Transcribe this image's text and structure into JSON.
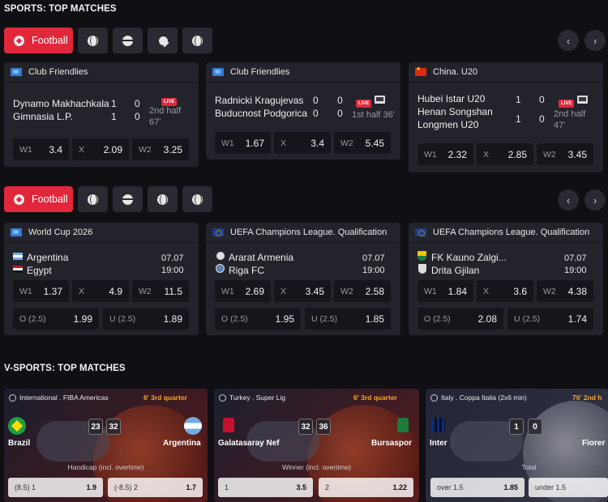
{
  "sports_title": "SPORTS: TOP MATCHES",
  "vsports_title": "V-SPORTS: TOP MATCHES",
  "tabs": {
    "active_label": "Football"
  },
  "nav": {
    "prev": "‹",
    "next": "›"
  },
  "live_label": "LIVE",
  "row1": [
    {
      "league": "Club Friendlies",
      "team1": "Dynamo Makhachkala",
      "team2": "Gimnasia L.P.",
      "s1a": "1",
      "s1b": "0",
      "s2a": "1",
      "s2b": "0",
      "period": "2nd half",
      "minute": "67'",
      "odds": [
        {
          "k": "W1",
          "v": "3.4"
        },
        {
          "k": "X",
          "v": "2.09"
        },
        {
          "k": "W2",
          "v": "3.25"
        }
      ]
    },
    {
      "league": "Club Friendlies",
      "team1": "Radnicki Kragujevas",
      "team2": "Buducnost Podgorica",
      "s1a": "0",
      "s1b": "0",
      "s2a": "0",
      "s2b": "0",
      "period": "1st half 36'",
      "odds": [
        {
          "k": "W1",
          "v": "1.67"
        },
        {
          "k": "X",
          "v": "3.4"
        },
        {
          "k": "W2",
          "v": "5.45"
        }
      ]
    },
    {
      "league": "China. U20",
      "team1": "Hubei Istar U20",
      "team2a": "Henan Songshan",
      "team2b": "Longmen U20",
      "s1a": "1",
      "s1b": "0",
      "s2a": "1",
      "s2b": "0",
      "period": "2nd half",
      "minute": "47'",
      "odds": [
        {
          "k": "W1",
          "v": "2.32"
        },
        {
          "k": "X",
          "v": "2.85"
        },
        {
          "k": "W2",
          "v": "3.45"
        }
      ]
    }
  ],
  "row2": [
    {
      "league": "World Cup 2026",
      "team1": "Argentina",
      "team2": "Egypt",
      "date": "07.07",
      "time": "19:00",
      "odds": [
        {
          "k": "W1",
          "v": "1.37"
        },
        {
          "k": "X",
          "v": "4.9"
        },
        {
          "k": "W2",
          "v": "11.5"
        }
      ],
      "totals": [
        {
          "k": "O (2.5)",
          "v": "1.99"
        },
        {
          "k": "U (2.5)",
          "v": "1.89"
        }
      ]
    },
    {
      "league": "UEFA Champions League. Qualification",
      "team1": "Ararat Armenia",
      "team2": "Riga FC",
      "date": "07.07",
      "time": "19:00",
      "odds": [
        {
          "k": "W1",
          "v": "2.69"
        },
        {
          "k": "X",
          "v": "3.45"
        },
        {
          "k": "W2",
          "v": "2.58"
        }
      ],
      "totals": [
        {
          "k": "O (2.5)",
          "v": "1.95"
        },
        {
          "k": "U (2.5)",
          "v": "1.85"
        }
      ]
    },
    {
      "league": "UEFA Champions League. Qualification",
      "team1": "FK Kauno Zalgi...",
      "team2": "Drita Gjilan",
      "date": "07.07",
      "time": "19:00",
      "odds": [
        {
          "k": "W1",
          "v": "1.84"
        },
        {
          "k": "X",
          "v": "3.6"
        },
        {
          "k": "W2",
          "v": "4.38"
        }
      ],
      "totals": [
        {
          "k": "O (2.5)",
          "v": "2.08"
        },
        {
          "k": "U (2.5)",
          "v": "1.74"
        }
      ]
    }
  ],
  "vsports": [
    {
      "league": "International . FIBA Americas",
      "time": "6' 3rd quarter",
      "team1": "Brazil",
      "team2": "Argentina",
      "score1": "23",
      "score2": "32",
      "market": "Handicap (incl. overtime)",
      "odds": [
        {
          "k": "(8.5) 1",
          "v": "1.9"
        },
        {
          "k": "(-8.5) 2",
          "v": "1.7"
        }
      ]
    },
    {
      "league": "Turkey . Super Lig",
      "time": "6' 3rd quarter",
      "team1": "Galatasaray Nef",
      "team2": "Bursaspor",
      "score1": "32",
      "score2": "36",
      "market": "Winner (incl. overtime)",
      "odds": [
        {
          "k": "1",
          "v": "3.5"
        },
        {
          "k": "2",
          "v": "1.22"
        }
      ]
    },
    {
      "league": "Italy . Coppa Italia (2x6 min)",
      "time": "76' 2nd h",
      "team1": "Inter",
      "team2": "Fiorer",
      "score1": "1",
      "score2": "0",
      "market": "Total",
      "odds": [
        {
          "k": "over 1.5",
          "v": "1.85"
        },
        {
          "k": "under 1.5",
          "v": ""
        }
      ]
    }
  ],
  "colors": {
    "accent": "#e2273b",
    "card": "#23232b",
    "bg": "#0f0f14",
    "odd": "#15151b"
  }
}
